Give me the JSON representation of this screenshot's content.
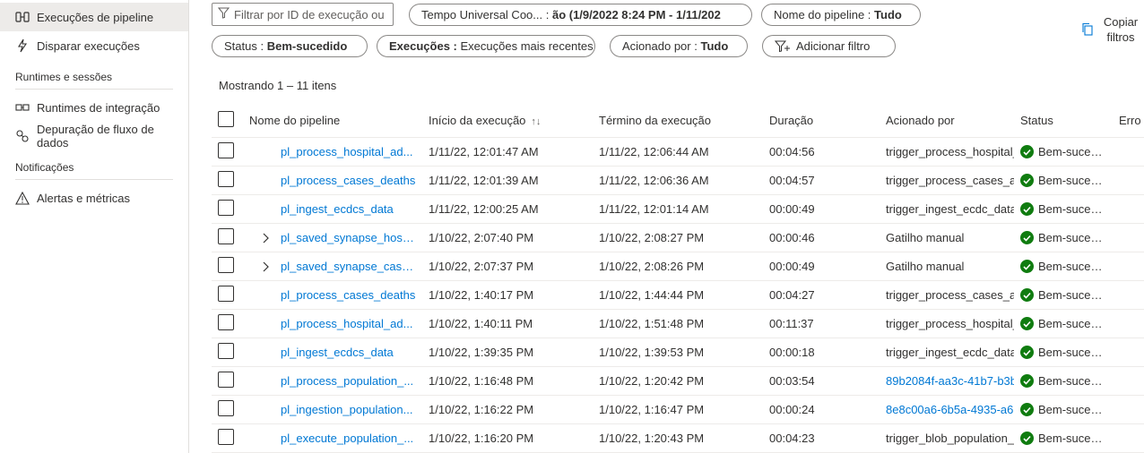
{
  "sidebar": {
    "items_top": [
      {
        "label": "Execuções de pipeline",
        "icon": "pipeline-runs-icon",
        "active": true
      },
      {
        "label": "Disparar execuções",
        "icon": "trigger-runs-icon",
        "active": false
      }
    ],
    "section_runtimes": "Runtimes e sessões",
    "items_runtimes": [
      {
        "label": "Runtimes de integração",
        "icon": "integration-runtime-icon"
      },
      {
        "label": "Depuração de fluxo de dados",
        "icon": "dataflow-debug-icon"
      }
    ],
    "section_notifications": "Notificações",
    "items_notifications": [
      {
        "label": "Alertas e métricas",
        "icon": "alert-icon"
      }
    ]
  },
  "filters": {
    "search_placeholder": "Filtrar por ID de execução ou nome",
    "time_label": "Tempo Universal Coo... :",
    "time_value": "ão (1/9/2022 8:24 PM - 1/11/202",
    "pipeline_label": "Nome do pipeline :",
    "pipeline_value": "Tudo",
    "status_label": "Status :",
    "status_value": "Bem-sucedido",
    "runs_label": "Execuções :",
    "runs_value": "Execuções mais recentes",
    "triggered_label": "Acionado por :",
    "triggered_value": "Tudo",
    "add_filter": "Adicionar filtro",
    "copy_filters": "Copiar filtros"
  },
  "showing": "Mostrando 1 – 11 itens",
  "columns": {
    "name": "Nome do pipeline",
    "start": "Início da execução",
    "end": "Término da execução",
    "duration": "Duração",
    "triggered": "Acionado por",
    "status": "Status",
    "error": "Erro"
  },
  "rows": [
    {
      "name": "pl_process_hospital_ad...",
      "start": "1/11/22, 12:01:47 AM",
      "end": "1/11/22, 12:06:44 AM",
      "duration": "00:04:56",
      "triggered": "trigger_process_hospital_",
      "status": "Bem-suced...",
      "expandable": false,
      "trig_link": false
    },
    {
      "name": "pl_process_cases_deaths",
      "start": "1/11/22, 12:01:39 AM",
      "end": "1/11/22, 12:06:36 AM",
      "duration": "00:04:57",
      "triggered": "trigger_process_cases_an",
      "status": "Bem-suced...",
      "expandable": false,
      "trig_link": false
    },
    {
      "name": "pl_ingest_ecdcs_data",
      "start": "1/11/22, 12:00:25 AM",
      "end": "1/11/22, 12:01:14 AM",
      "duration": "00:00:49",
      "triggered": "trigger_ingest_ecdc_data",
      "status": "Bem-suced...",
      "expandable": false,
      "trig_link": false
    },
    {
      "name": "pl_saved_synapse_hospit...",
      "start": "1/10/22, 2:07:40 PM",
      "end": "1/10/22, 2:08:27 PM",
      "duration": "00:00:46",
      "triggered": "Gatilho manual",
      "status": "Bem-suced...",
      "expandable": true,
      "trig_link": false
    },
    {
      "name": "pl_saved_synapse_case_a...",
      "start": "1/10/22, 2:07:37 PM",
      "end": "1/10/22, 2:08:26 PM",
      "duration": "00:00:49",
      "triggered": "Gatilho manual",
      "status": "Bem-suced...",
      "expandable": true,
      "trig_link": false
    },
    {
      "name": "pl_process_cases_deaths",
      "start": "1/10/22, 1:40:17 PM",
      "end": "1/10/22, 1:44:44 PM",
      "duration": "00:04:27",
      "triggered": "trigger_process_cases_an",
      "status": "Bem-suced...",
      "expandable": false,
      "trig_link": false
    },
    {
      "name": "pl_process_hospital_ad...",
      "start": "1/10/22, 1:40:11 PM",
      "end": "1/10/22, 1:51:48 PM",
      "duration": "00:11:37",
      "triggered": "trigger_process_hospital_",
      "status": "Bem-suced...",
      "expandable": false,
      "trig_link": false
    },
    {
      "name": "pl_ingest_ecdcs_data",
      "start": "1/10/22, 1:39:35 PM",
      "end": "1/10/22, 1:39:53 PM",
      "duration": "00:00:18",
      "triggered": "trigger_ingest_ecdc_data",
      "status": "Bem-suced...",
      "expandable": false,
      "trig_link": false
    },
    {
      "name": "pl_process_population_...",
      "start": "1/10/22, 1:16:48 PM",
      "end": "1/10/22, 1:20:42 PM",
      "duration": "00:03:54",
      "triggered": "89b2084f-aa3c-41b7-b3b",
      "status": "Bem-suced...",
      "expandable": false,
      "trig_link": true
    },
    {
      "name": "pl_ingestion_population...",
      "start": "1/10/22, 1:16:22 PM",
      "end": "1/10/22, 1:16:47 PM",
      "duration": "00:00:24",
      "triggered": "8e8c00a6-6b5a-4935-a6",
      "status": "Bem-suced...",
      "expandable": false,
      "trig_link": true
    },
    {
      "name": "pl_execute_population_...",
      "start": "1/10/22, 1:16:20 PM",
      "end": "1/10/22, 1:20:43 PM",
      "duration": "00:04:23",
      "triggered": "trigger_blob_population_",
      "status": "Bem-suced...",
      "expandable": false,
      "trig_link": false
    }
  ],
  "colors": {
    "accent": "#0078d4",
    "success": "#107c10",
    "selected_bg": "#edebe9"
  }
}
